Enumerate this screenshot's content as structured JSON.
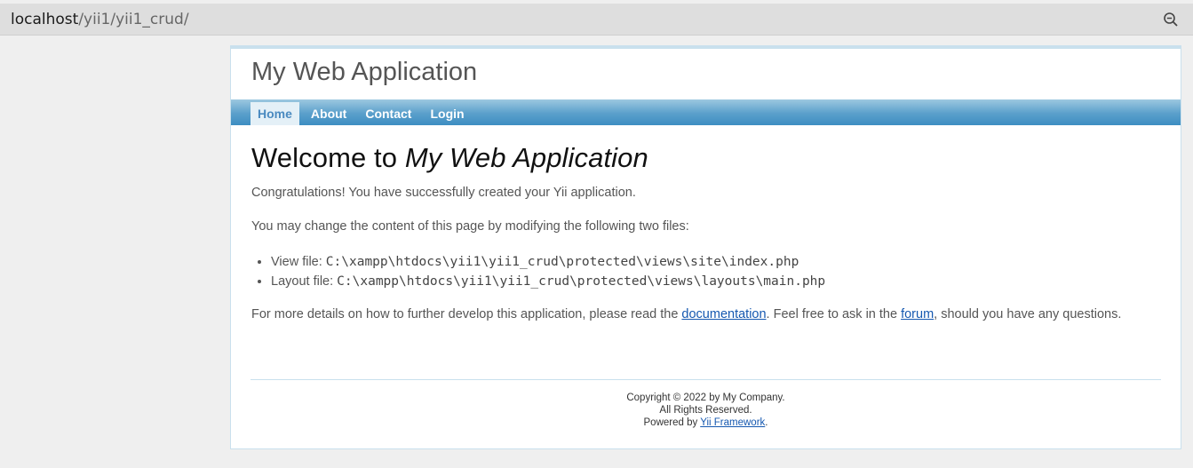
{
  "browser": {
    "url_host": "localhost",
    "url_path": "/yii1/yii1_crud/"
  },
  "header": {
    "logo": "My Web Application"
  },
  "menu": {
    "items": [
      {
        "label": "Home",
        "active": true
      },
      {
        "label": "About"
      },
      {
        "label": "Contact"
      },
      {
        "label": "Login"
      }
    ]
  },
  "content": {
    "heading_prefix": "Welcome to ",
    "heading_app": "My Web Application",
    "congrats": "Congratulations! You have successfully created your Yii application.",
    "change_intro": "You may change the content of this page by modifying the following two files:",
    "view_file_label": "View file: ",
    "view_file_path": "C:\\xampp\\htdocs\\yii1\\yii1_crud\\protected\\views\\site\\index.php",
    "layout_file_label": "Layout file: ",
    "layout_file_path": "C:\\xampp\\htdocs\\yii1\\yii1_crud\\protected\\views\\layouts\\main.php",
    "details_pre": "For more details on how to further develop this application, please read the ",
    "documentation_link": "documentation",
    "details_mid": ". Feel free to ask in the ",
    "forum_link": "forum",
    "details_post": ", should you have any questions."
  },
  "footer": {
    "copyright": "Copyright © 2022 by My Company.",
    "rights": "All Rights Reserved.",
    "powered_pre": "Powered by ",
    "framework_link": "Yii Framework",
    "powered_post": "."
  }
}
